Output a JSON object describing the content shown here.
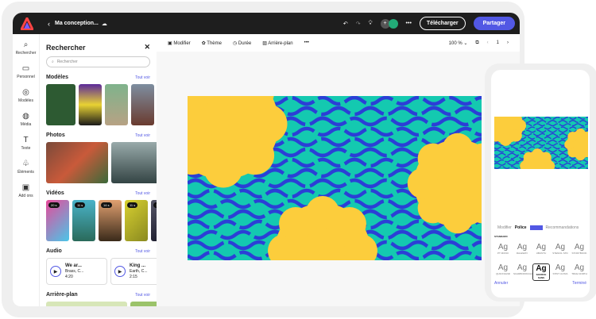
{
  "topbar": {
    "title": "Ma conception...",
    "download": "Télécharger",
    "share": "Partager"
  },
  "rail": [
    {
      "icon": "search-icon",
      "label": "Rechercher",
      "g": "⌕"
    },
    {
      "icon": "folder-icon",
      "label": "Personnel",
      "g": "▭"
    },
    {
      "icon": "templates-icon",
      "label": "Modèles",
      "g": "◎"
    },
    {
      "icon": "media-icon",
      "label": "Média",
      "g": "◍"
    },
    {
      "icon": "text-icon",
      "label": "Texte",
      "g": "T"
    },
    {
      "icon": "elements-icon",
      "label": "Éléments",
      "g": "♧"
    },
    {
      "icon": "addons-icon",
      "label": "Add ons",
      "g": "▣"
    }
  ],
  "panel": {
    "title": "Rechercher",
    "search_placeholder": "Rechercher",
    "see_all": "Tout voir",
    "sections": {
      "templates": "Modèles",
      "photos": "Photos",
      "videos": "Vidéos",
      "audio": "Audio",
      "background": "Arrière-plan"
    },
    "videos": [
      "20 s",
      "11 s",
      "14 s",
      "11 s",
      "17"
    ],
    "audio": [
      {
        "title": "We ar...",
        "artist": "Brass, C...",
        "duration": "4:20"
      },
      {
        "title": "King ...",
        "artist": "Earth, C...",
        "duration": "2:15"
      }
    ]
  },
  "toolbar": {
    "edit": "Modifier",
    "theme": "Thème",
    "duration": "Durée",
    "background": "Arrière-plan",
    "more": "•••",
    "zoom": "100 %",
    "page": "1"
  },
  "phone": {
    "tabs": [
      "Modifier",
      "Police",
      "Recommandations"
    ],
    "badge": "Nouveau",
    "section": "STANDARD",
    "fonts": [
      "PT MONO",
      "RALEWAY",
      "UBUNTU",
      "STENCIL STD",
      "STORYBOOK",
      "QUICKSAND",
      "SCARBOROUGH",
      "SOURCE SANS",
      "STINT ULTRA",
      "TRUE NORTH"
    ],
    "cancel": "Annuler",
    "done": "Terminé"
  },
  "colors": {
    "accent": "#5258e4",
    "teal": "#14c9b0",
    "blue": "#2b3fd6",
    "yellow": "#fccd3c"
  }
}
